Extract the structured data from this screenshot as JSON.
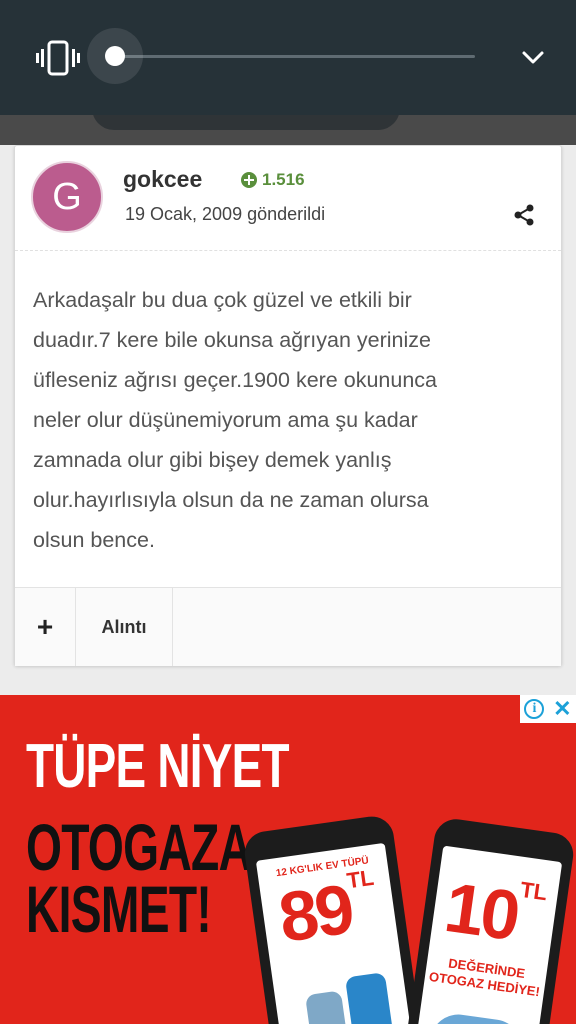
{
  "volume_panel": {
    "mode_icon": "vibrate-icon",
    "level": 0,
    "expand_icon": "chevron-down-icon"
  },
  "post": {
    "avatar_letter": "G",
    "avatar_color": "#bb5c8e",
    "username": "gokcee",
    "reputation": "1.516",
    "reputation_color": "#5a8f3c",
    "date": "19 Ocak, 2009 gönderildi",
    "share_icon": "share-icon",
    "content_lines": [
      "Arkadaşalr bu dua çok güzel ve etkili bir",
      "duadır.7 kere bile okunsa ağrıyan yerinize",
      "üfleseniz ağrısı geçer.1900 kere okununca",
      "neler olur düşünemiyorum ama şu kadar",
      "zamnada olur gibi bişey demek yanlış",
      "olur.hayırlısıyla olsun da ne zaman olursa",
      "olsun bence."
    ],
    "footer": {
      "plus_label": "+",
      "quote_label": "Alıntı"
    }
  },
  "ad": {
    "background_color": "#e1251b",
    "info_icon": "i",
    "close_icon": "✕",
    "headline": [
      "TÜPE NİYET",
      "OTOGAZA",
      "KISMET!"
    ],
    "phone_left": {
      "top_text": "12 KG'LIK EV TÜPÜ",
      "price": "89",
      "unit": "TL"
    },
    "phone_right": {
      "price": "10",
      "unit": "TL",
      "line1": "DEĞERİNDE",
      "line2": "OTOGAZ HEDİYE!"
    }
  }
}
